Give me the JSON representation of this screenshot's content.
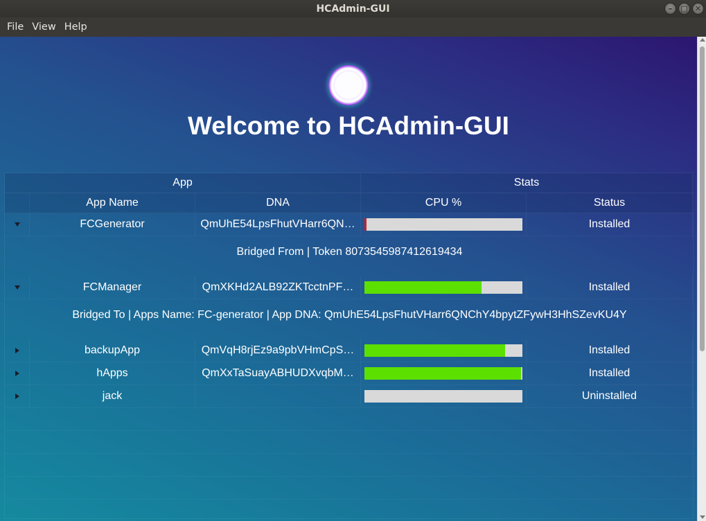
{
  "window": {
    "title": "HCAdmin-GUI",
    "controls": [
      "–",
      "□",
      "✕"
    ]
  },
  "menu": [
    "File",
    "View",
    "Help"
  ],
  "welcome": "Welcome to HCAdmin-GUI",
  "table": {
    "groups": {
      "app": "App",
      "stats": "Stats"
    },
    "columns": {
      "name": "App Name",
      "dna": "DNA",
      "cpu": "CPU %",
      "status": "Status"
    },
    "rows": [
      {
        "name": "FCGenerator",
        "dna": "QmUhE54LpsFhutVHarr6QN…",
        "cpu": 0.01,
        "cpu_color": "#c8202a",
        "status": "Installed",
        "expanded": true,
        "detail": "Bridged From | Token 8073545987412619434"
      },
      {
        "name": "FCManager",
        "dna": "QmXKHd2ALB92ZKTcctnPF…",
        "cpu": 0.74,
        "cpu_color": "#5ce000",
        "status": "Installed",
        "expanded": true,
        "detail": "Bridged To | Apps Name: FC-generator | App DNA: QmUhE54LpsFhutVHarr6QNChY4bpytZFywH3HhSZevKU4Y"
      },
      {
        "name": "backupApp",
        "dna": "QmVqH8rjEz9a9pbVHmCpS…",
        "cpu": 0.89,
        "cpu_color": "#5ce000",
        "status": "Installed",
        "expanded": false
      },
      {
        "name": "hApps",
        "dna": "QmXxTaSuayABHUDXvqbM…",
        "cpu": 0.99,
        "cpu_color": "#5ce000",
        "status": "Installed",
        "expanded": false
      },
      {
        "name": "jack",
        "dna": "",
        "cpu": 0,
        "cpu_color": "#5ce000",
        "status": "Uninstalled",
        "expanded": false
      }
    ]
  }
}
